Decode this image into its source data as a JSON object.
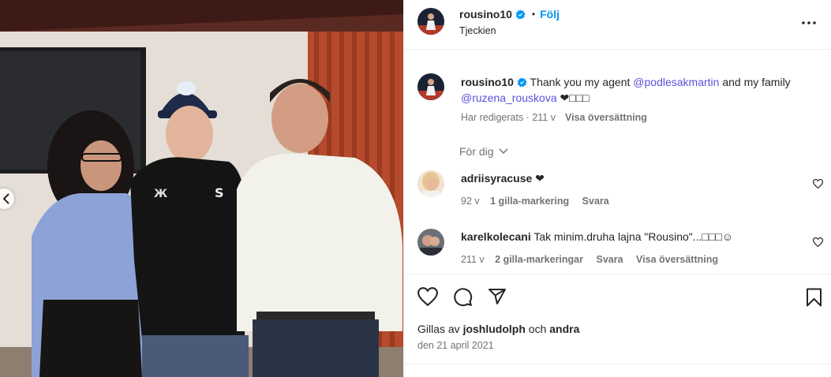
{
  "post": {
    "username": "rousino10",
    "follow_label": "Följ",
    "dot": "•",
    "location": "Tjeckien"
  },
  "caption": {
    "username": "rousino10",
    "text_before": " Thank you my agent ",
    "mention_agent": "@podlesakmartin",
    "text_middle": " and my family ",
    "mention_family": "@ruzena_rouskova",
    "text_after": " ❤□□□",
    "edited": "Har redigerats",
    "separator": " · ",
    "age": "211 v",
    "translate": "Visa översättning"
  },
  "for_you": "För dig",
  "comments": [
    {
      "username": "adriisyracuse",
      "text": " ❤",
      "age": "92 v",
      "likes": "1 gilla-markering",
      "reply": "Svara"
    },
    {
      "username": "karelkolecani",
      "text": " Tak minim.druha lajna \"Rousino\"...□□□☺",
      "age": "211 v",
      "likes": "2 gilla-markeringar",
      "reply": "Svara",
      "translate": "Visa översättning"
    }
  ],
  "likes": {
    "prefix": "Gillas av ",
    "user": "joshludolph",
    "middle": " och ",
    "others": "andra"
  },
  "date": "den 21 april 2021",
  "icons": {
    "verified": "verified-badge-icon",
    "more": "more-options-icon",
    "like": "heart-icon",
    "comment": "comment-icon",
    "share": "share-icon",
    "save": "bookmark-icon",
    "prev": "chevron-left-icon",
    "chevron": "chevron-down-icon"
  },
  "colors": {
    "accent": "#0095f6",
    "mention": "#5851db",
    "muted": "#737373",
    "text": "#262626"
  }
}
